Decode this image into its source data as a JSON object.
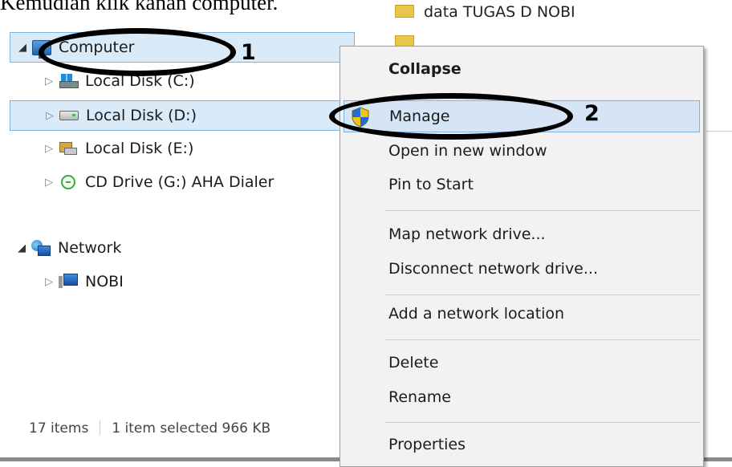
{
  "caption": "Kemudian klik kanan computer.",
  "top_folder_label": "data TUGAS D NOBI",
  "tree": {
    "computer": "Computer",
    "local_c": "Local Disk (C:)",
    "local_d": "Local Disk (D:)",
    "local_e": "Local Disk (E:)",
    "cd_drive": "CD Drive (G:) AHA Dialer",
    "network": "Network",
    "nobi": "NOBI"
  },
  "status_bar": {
    "items_count": "17 items",
    "selected": "1 item selected  966 KB"
  },
  "context_menu": {
    "collapse": "Collapse",
    "manage": "Manage",
    "open_new_window": "Open in new window",
    "pin_to_start": "Pin to Start",
    "map_network_drive": "Map network drive...",
    "disconnect_network_drive": "Disconnect network drive...",
    "add_network_location": "Add a network location",
    "delete": "Delete",
    "rename": "Rename",
    "properties": "Properties"
  },
  "annotations": {
    "step1": "1",
    "step2": "2"
  },
  "icons": {
    "computer": "computer-icon",
    "local_c": "windows-drive-icon",
    "local_d": "hard-drive-icon",
    "local_e": "image-drive-icon",
    "cd_drive": "cd-drive-icon",
    "network": "network-icon",
    "nobi": "network-computer-icon",
    "manage": "uac-shield-icon"
  },
  "colors": {
    "selection_bg": "#d9ebf9",
    "selection_border": "#7ab3e3",
    "menu_bg": "#f2f2f2"
  }
}
